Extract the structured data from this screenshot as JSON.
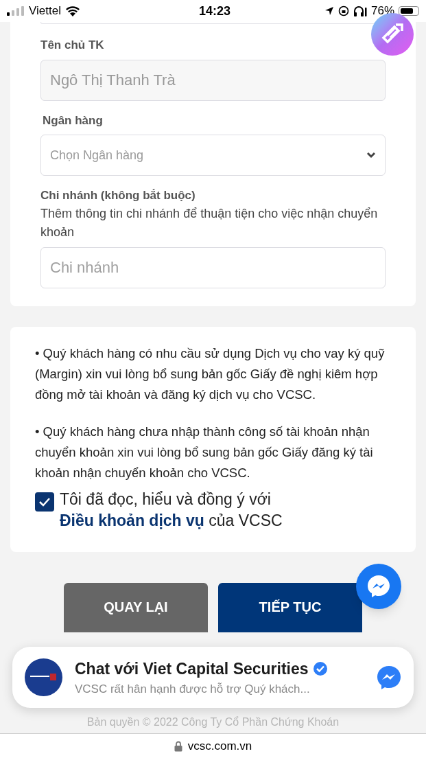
{
  "status_bar": {
    "carrier": "Viettel",
    "time": "14:23",
    "battery": "76%"
  },
  "form": {
    "fields": [
      {
        "kind": "text",
        "label": "Tên chủ TK",
        "value": "Ngô Thị Thanh Trà",
        "disabled": true
      },
      {
        "kind": "select",
        "label": "Ngân hàng",
        "placeholder": "Chọn Ngân hàng",
        "disabled": false
      },
      {
        "kind": "text",
        "label": "Chi nhánh (không bắt buộc)",
        "hint": "Thêm thông tin chi nhánh để thuận tiện cho việc nhận chuyển khoản",
        "placeholder": "Chi nhánh",
        "disabled": false
      }
    ]
  },
  "notes": [
    "• Quý khách hàng có nhu cầu sử dụng Dịch vụ cho vay ký quỹ (Margin) xin vui lòng bổ sung bản gốc Giấy đề nghị kiêm hợp đồng mở tài khoản và đăng ký dịch vụ cho VCSC.",
    "• Quý khách hàng chưa nhập thành công số tài khoản nhận chuyển khoản xin vui lòng bổ sung bản gốc Giấy đăng ký tài khoản nhận chuyển khoản cho VCSC."
  ],
  "agreement": {
    "checked": true,
    "text_before": "Tôi đã đọc, hiểu và đồng ý với ",
    "link": "Điều khoản dịch vụ",
    "text_after": " của VCSC"
  },
  "buttons": [
    {
      "kind": "secondary",
      "label": "QUAY LẠI"
    },
    {
      "kind": "primary",
      "label": "TIẾP TỤC"
    }
  ],
  "chat_popup": {
    "title": "Chat với Viet Capital Securities",
    "message": "VCSC rất hân hạnh được hỗ trợ Quý khách..."
  },
  "footer": "Bản quyền © 2022 Công Ty Cổ Phần Chứng Khoán",
  "url_bar": {
    "url": "vcsc.com.vn"
  }
}
